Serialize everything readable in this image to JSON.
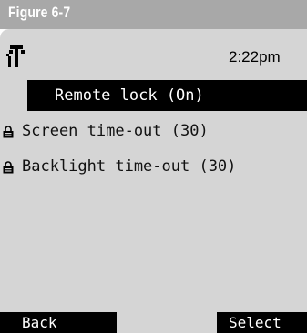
{
  "figure": {
    "label": "Figure 6-7"
  },
  "status_bar": {
    "time": "2:22pm",
    "signal_icon": "antenna-signal-icon"
  },
  "menu": {
    "items": [
      {
        "label": "Remote lock (On)",
        "selected": true,
        "icon": ""
      },
      {
        "label": "Screen time-out (30)",
        "selected": false,
        "icon": "lock-icon"
      },
      {
        "label": "Backlight time-out (30)",
        "selected": false,
        "icon": "lock-icon"
      }
    ]
  },
  "softkeys": {
    "left_label": "Back",
    "right_label": "Select"
  },
  "colors": {
    "figure_bar": "#a8a8a8",
    "screen_background": "#d5d5d5",
    "highlight": "#000000",
    "highlight_text": "#ffffff"
  }
}
